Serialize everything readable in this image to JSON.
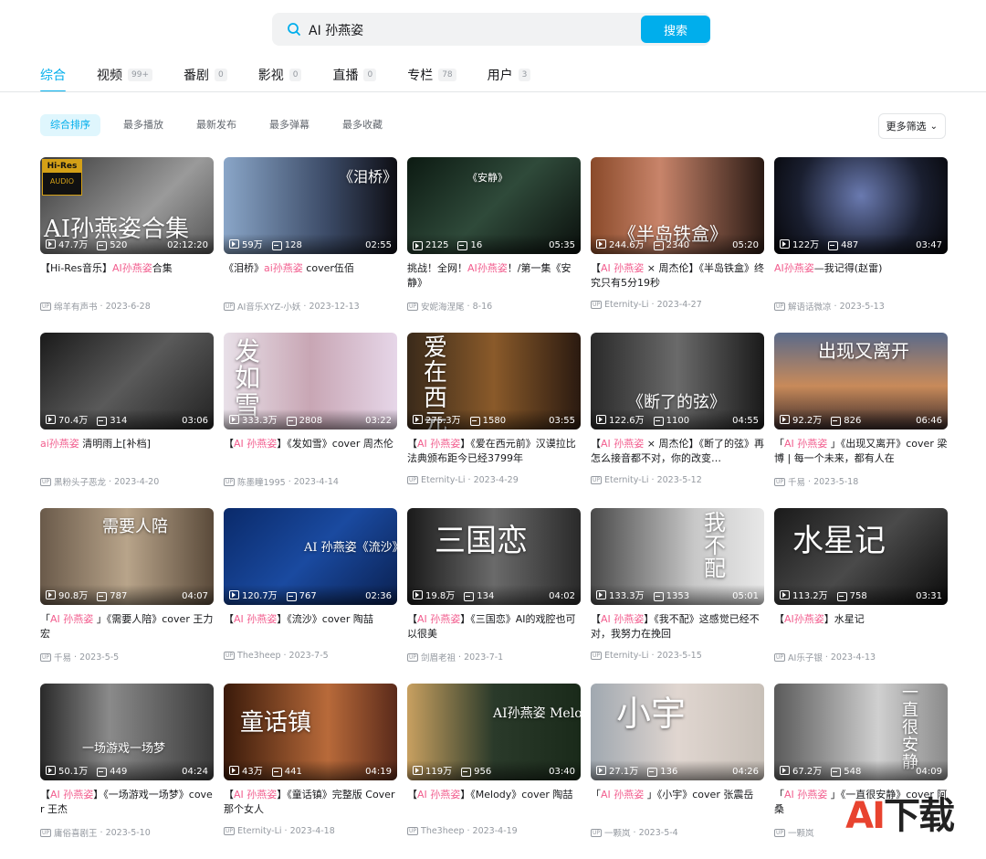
{
  "search": {
    "value": "AI 孙燕姿",
    "button": "搜索"
  },
  "tabs": [
    {
      "label": "综合",
      "count": ""
    },
    {
      "label": "视频",
      "count": "99+"
    },
    {
      "label": "番剧",
      "count": "0"
    },
    {
      "label": "影视",
      "count": "0"
    },
    {
      "label": "直播",
      "count": "0"
    },
    {
      "label": "专栏",
      "count": "78"
    },
    {
      "label": "用户",
      "count": "3"
    }
  ],
  "filters": [
    "综合排序",
    "最多播放",
    "最新发布",
    "最多弹幕",
    "最多收藏"
  ],
  "more_filters": "更多筛选",
  "hires_badge": {
    "line1": "Hi-Res",
    "line2": "AUDIO"
  },
  "watermark": "AI下载",
  "videos": [
    {
      "thumb_text": "AI孙燕姿合集",
      "plays": "47.7万",
      "danmaku": "520",
      "duration": "02:12:20",
      "title_pre": "【Hi-Res音乐】",
      "title_hl": "AI孙燕姿",
      "title_post": "合集",
      "up": "绵羊有声书",
      "date": "2023-6-28",
      "bg": "linear-gradient(135deg,#3a3a3a,#9a9a9a 60%,#555)"
    },
    {
      "thumb_text": "《泪桥》",
      "plays": "59万",
      "danmaku": "128",
      "duration": "02:55",
      "title_pre": "《泪桥》",
      "title_hl": "ai孙燕姿",
      "title_post": " cover伍佰",
      "up": "AI音乐XYZ-小妖",
      "date": "2023-12-13",
      "bg": "linear-gradient(90deg,#8aa6c8,#3b4a66 60%,#0e0e14)"
    },
    {
      "thumb_text": "《安静》",
      "plays": "2125",
      "danmaku": "16",
      "duration": "05:35",
      "title_pre": "挑战！全网！",
      "title_hl": "AI孙燕姿",
      "title_post": "！/第一集《安静》",
      "up": "安妮海涅尾",
      "date": "8-16",
      "bg": "linear-gradient(135deg,#0c1a12,#2f4a3a 50%,#0a0f0c)"
    },
    {
      "thumb_text": "《半岛铁盒》",
      "plays": "244.6万",
      "danmaku": "2340",
      "duration": "05:20",
      "title_pre": "【",
      "title_hl": "AI 孙燕姿",
      "title_post": " × 周杰伦】《半岛铁盒》终究只有5分19秒",
      "up": "Eternity-Li",
      "date": "2023-4-27",
      "bg": "linear-gradient(90deg,#8a4a2a,#c8846a 40%,#2a1a14)"
    },
    {
      "thumb_text": "",
      "plays": "122万",
      "danmaku": "487",
      "duration": "03:47",
      "title_pre": "",
      "title_hl": "AI孙燕姿",
      "title_post": "—我记得(赵雷)",
      "up": "解语话微凉",
      "date": "2023-5-13",
      "bg": "radial-gradient(circle at 50% 40%,#6a7ab0,#1a1f30 60%,#050508)"
    },
    {
      "thumb_text": "",
      "plays": "70.4万",
      "danmaku": "314",
      "duration": "03:06",
      "title_pre": "",
      "title_hl": "ai孙燕姿",
      "title_post": " 清明雨上[补档]",
      "up": "黑粉头子恶龙",
      "date": "2023-4-20",
      "bg": "linear-gradient(135deg,#1a1a1a,#5a5a5a 50%,#222)"
    },
    {
      "thumb_text": "发如雪",
      "plays": "333.3万",
      "danmaku": "2808",
      "duration": "03:22",
      "title_pre": "【",
      "title_hl": "AI 孙燕姿",
      "title_post": "】《发如雪》cover 周杰伦",
      "up": "陈墨瞳1995",
      "date": "2023-4-14",
      "bg": "linear-gradient(90deg,#e8e0e8,#c8a6b4 50%,#e6d6e8)"
    },
    {
      "thumb_text": "爱在西元前",
      "plays": "275.3万",
      "danmaku": "1580",
      "duration": "03:55",
      "title_pre": "【",
      "title_hl": "AI 孙燕姿",
      "title_post": "】《爱在西元前》汉谟拉比法典颁布距今已经3799年",
      "up": "Eternity-Li",
      "date": "2023-4-29",
      "bg": "linear-gradient(90deg,#3a2a1a,#8a5a2a 50%,#2a1a10)"
    },
    {
      "thumb_text": "《断了的弦》",
      "plays": "122.6万",
      "danmaku": "1100",
      "duration": "04:55",
      "title_pre": "【",
      "title_hl": "AI 孙燕姿",
      "title_post": " × 周杰伦】《断了的弦》再怎么接音都不对，你的改变…",
      "up": "Eternity-Li",
      "date": "2023-5-12",
      "bg": "linear-gradient(90deg,#2a2a2a,#6a6a6a 50%,#1a1a1a)"
    },
    {
      "thumb_text": "出现又离开",
      "plays": "92.2万",
      "danmaku": "826",
      "duration": "06:46",
      "title_pre": "「",
      "title_hl": "AI 孙燕姿",
      "title_post": " 」《出现又离开》cover 梁博 | 每一个未来，都有人在",
      "up": "千易",
      "date": "2023-5-18",
      "bg": "linear-gradient(180deg,#5a6a8a,#c88a5a 55%,#3a2a2a)"
    },
    {
      "thumb_text": "需要人陪",
      "plays": "90.8万",
      "danmaku": "787",
      "duration": "04:07",
      "title_pre": "「",
      "title_hl": "AI 孙燕姿",
      "title_post": " 」《需要人陪》cover 王力宏",
      "up": "千易",
      "date": "2023-5-5",
      "bg": "linear-gradient(90deg,#6a5a4a,#b8a48a 50%,#5a4a3a)"
    },
    {
      "thumb_text": "AI 孙燕姿《流沙》",
      "plays": "120.7万",
      "danmaku": "767",
      "duration": "02:36",
      "title_pre": "【",
      "title_hl": "AI 孙燕姿",
      "title_post": "】《流沙》cover 陶喆",
      "up": "The3heep",
      "date": "2023-7-5",
      "bg": "linear-gradient(135deg,#0a2a6a,#1a4aa0 50%,#0a2050)"
    },
    {
      "thumb_text": "三国恋",
      "plays": "19.8万",
      "danmaku": "134",
      "duration": "04:02",
      "title_pre": "【",
      "title_hl": "AI 孙燕姿",
      "title_post": "】《三国恋》AI的戏腔也可以很美",
      "up": "剑眉老祖",
      "date": "2023-7-1",
      "bg": "linear-gradient(90deg,#1a1a1a,#6a6a6a 50%,#2a2a2a)"
    },
    {
      "thumb_text": "我不配",
      "plays": "133.3万",
      "danmaku": "1353",
      "duration": "05:01",
      "title_pre": "【",
      "title_hl": "AI 孙燕姿",
      "title_post": "】《我不配》这感觉已经不对，我努力在挽回",
      "up": "Eternity-Li",
      "date": "2023-5-15",
      "bg": "linear-gradient(90deg,#4a4a4a,#c8c8c8 60%,#e8e8e8)"
    },
    {
      "thumb_text": "水星记",
      "plays": "113.2万",
      "danmaku": "758",
      "duration": "03:31",
      "title_pre": "【",
      "title_hl": "AI孙燕姿",
      "title_post": "】水星记",
      "up": "AI乐子银",
      "date": "2023-4-13",
      "bg": "linear-gradient(135deg,#1a1a1a,#4a4a4a 50%,#0a0a0a)"
    },
    {
      "thumb_text": "一场游戏一场梦",
      "plays": "50.1万",
      "danmaku": "449",
      "duration": "04:24",
      "title_pre": "【",
      "title_hl": "AI 孙燕姿",
      "title_post": "】《一场游戏一场梦》cover 王杰",
      "up": "庸俗喜剧王",
      "date": "2023-5-10",
      "bg": "linear-gradient(90deg,#2a2a2a,#8a8a8a 40%,#3a3a3a)"
    },
    {
      "thumb_text": "童话镇",
      "plays": "43万",
      "danmaku": "441",
      "duration": "04:19",
      "title_pre": "【",
      "title_hl": "AI 孙燕姿",
      "title_post": "】《童话镇》完整版 Cover 那个女人",
      "up": "Eternity-Li",
      "date": "2023-4-18",
      "bg": "linear-gradient(90deg,#3a1a0a,#b86a3a 60%,#5a2a1a)"
    },
    {
      "thumb_text": "AI孙燕姿 Melody",
      "plays": "119万",
      "danmaku": "956",
      "duration": "03:40",
      "title_pre": "【",
      "title_hl": "AI 孙燕姿",
      "title_post": "】《Melody》cover 陶喆",
      "up": "The3heep",
      "date": "2023-4-19",
      "bg": "linear-gradient(90deg,#c8a060,#2a3a2a 50%,#1a2a1a)"
    },
    {
      "thumb_text": "小宇",
      "plays": "27.1万",
      "danmaku": "136",
      "duration": "04:26",
      "title_pre": "「",
      "title_hl": "AI 孙燕姿",
      "title_post": " 」《小宇》cover 张震岳",
      "up": "一颗岚",
      "date": "2023-5-4",
      "bg": "linear-gradient(90deg,#a0a8b0,#e0d6d0 50%,#c8c0b8)"
    },
    {
      "thumb_text": "一直很安静",
      "plays": "67.2万",
      "danmaku": "548",
      "duration": "04:09",
      "title_pre": "「",
      "title_hl": "AI 孙燕姿",
      "title_post": " 」《一直很安静》cover 阿桑",
      "up": "一颗岚",
      "date": "",
      "bg": "linear-gradient(90deg,#5a5a5a,#d0d0d0 60%,#8a8a8a)"
    }
  ]
}
